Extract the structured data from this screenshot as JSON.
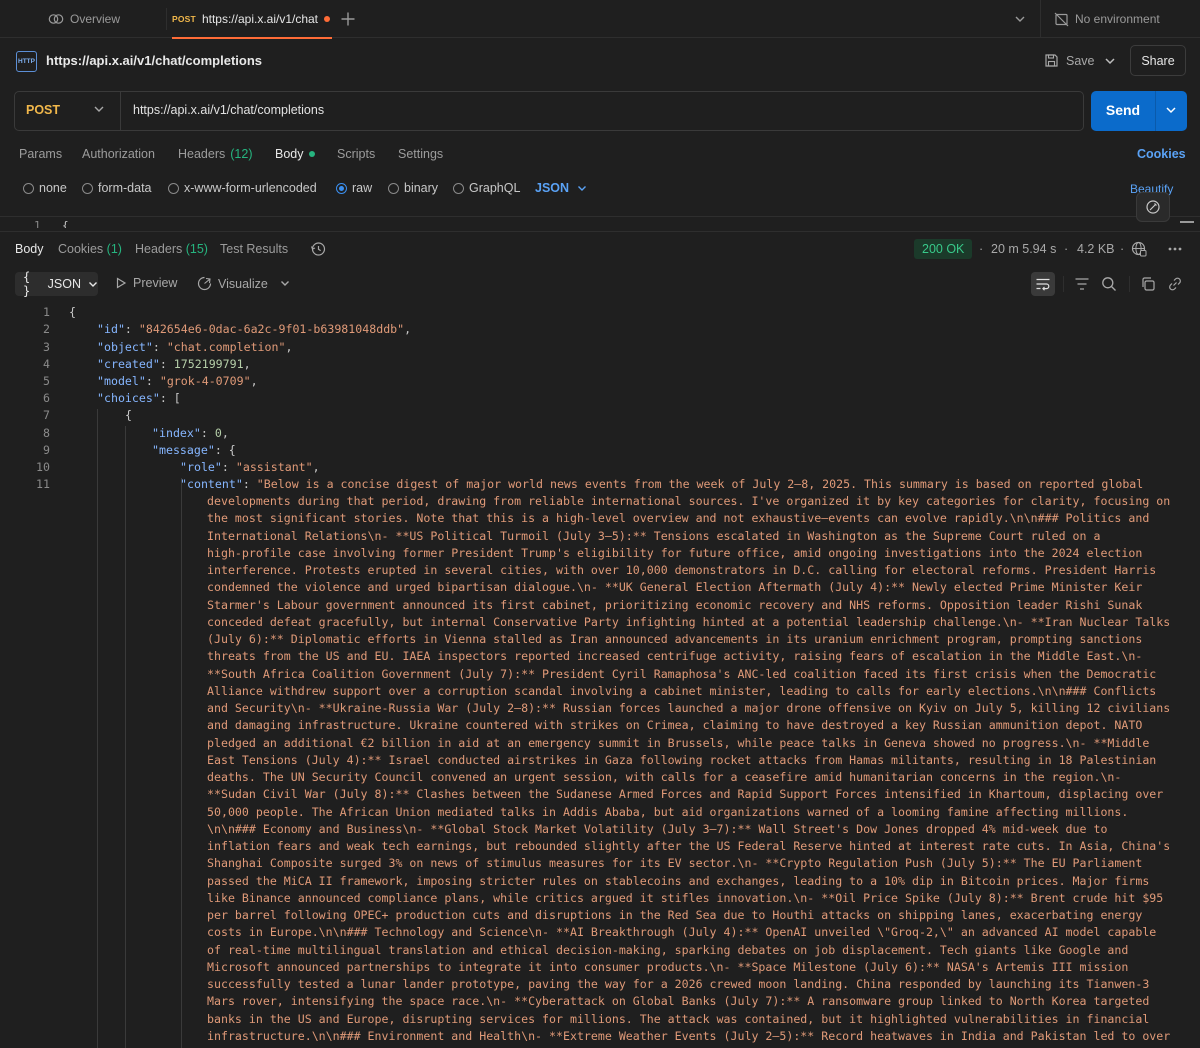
{
  "tabs": {
    "overview_label": "Overview",
    "active_method": "POST",
    "active_label": "https://api.x.ai/v1/chat",
    "environment_label": "No environment"
  },
  "header": {
    "badge": "HTTP",
    "title": "https://api.x.ai/v1/chat/completions",
    "save_label": "Save",
    "share_label": "Share"
  },
  "request": {
    "method": "POST",
    "url": "https://api.x.ai/v1/chat/completions",
    "send_label": "Send",
    "tabs": {
      "params": "Params",
      "authorization": "Authorization",
      "headers": "Headers",
      "headers_count": "(12)",
      "body": "Body",
      "scripts": "Scripts",
      "settings": "Settings"
    },
    "cookies_link": "Cookies",
    "body_types": {
      "none": "none",
      "form_data": "form-data",
      "urlencoded": "x-www-form-urlencoded",
      "raw": "raw",
      "binary": "binary",
      "graphql": "GraphQL"
    },
    "raw_format": "JSON",
    "beautify_label": "Beautify",
    "editor_peek_line": "1",
    "editor_peek_text": "{"
  },
  "response": {
    "tabs": {
      "body": "Body",
      "cookies": "Cookies",
      "cookies_count": "(1)",
      "headers": "Headers",
      "headers_count": "(15)",
      "test_results": "Test Results"
    },
    "status": "200 OK",
    "time": "20 m 5.94 s",
    "size": "4.2 KB",
    "view_format": "JSON",
    "preview_label": "Preview",
    "visualize_label": "Visualize",
    "json_lines": {
      "l1": "{",
      "id_key": "\"id\"",
      "id_val": "\"842654e6-0dac-6a2c-9f01-b63981048ddb\"",
      "object_key": "\"object\"",
      "object_val": "\"chat.completion\"",
      "created_key": "\"created\"",
      "created_val": "1752199791",
      "model_key": "\"model\"",
      "model_val": "\"grok-4-0709\"",
      "choices_key": "\"choices\"",
      "brace_open": "{",
      "index_key": "\"index\"",
      "index_val": "0",
      "message_key": "\"message\"",
      "role_key": "\"role\"",
      "role_val": "\"assistant\"",
      "content_key": "\"content\"",
      "content_first": "\"Below is a concise digest of major world news events from the week of July 2–8, 2025. This summary is based on reported global",
      "content_rest": [
        "developments during that period, drawing from reliable international sources. I've organized it by key categories for clarity, focusing on",
        "the most significant stories. Note that this is a high-level overview and not exhaustive—events can evolve rapidly.\\n\\n### Politics and",
        "International Relations\\n- **US Political Turmoil (July 3–5):** Tensions escalated in Washington as the Supreme Court ruled on a",
        "high-profile case involving former President Trump's eligibility for future office, amid ongoing investigations into the 2024 election",
        "interference. Protests erupted in several cities, with over 10,000 demonstrators in D.C. calling for electoral reforms. President Harris",
        "condemned the violence and urged bipartisan dialogue.\\n- **UK General Election Aftermath (July 4):** Newly elected Prime Minister Keir",
        "Starmer's Labour government announced its first cabinet, prioritizing economic recovery and NHS reforms. Opposition leader Rishi Sunak",
        "conceded defeat gracefully, but internal Conservative Party infighting hinted at a potential leadership challenge.\\n- **Iran Nuclear Talks",
        "(July 6):** Diplomatic efforts in Vienna stalled as Iran announced advancements in its uranium enrichment program, prompting sanctions",
        "threats from the US and EU. IAEA inspectors reported increased centrifuge activity, raising fears of escalation in the Middle East.\\n-",
        "**South Africa Coalition Government (July 7):** President Cyril Ramaphosa's ANC-led coalition faced its first crisis when the Democratic",
        "Alliance withdrew support over a corruption scandal involving a cabinet minister, leading to calls for early elections.\\n\\n### Conflicts",
        "and Security\\n- **Ukraine-Russia War (July 2–8):** Russian forces launched a major drone offensive on Kyiv on July 5, killing 12 civilians",
        "and damaging infrastructure. Ukraine countered with strikes on Crimea, claiming to have destroyed a key Russian ammunition depot. NATO",
        "pledged an additional €2 billion in aid at an emergency summit in Brussels, while peace talks in Geneva showed no progress.\\n- **Middle",
        "East Tensions (July 4):** Israel conducted airstrikes in Gaza following rocket attacks from Hamas militants, resulting in 18 Palestinian",
        "deaths. The UN Security Council convened an urgent session, with calls for a ceasefire amid humanitarian concerns in the region.\\n-",
        "**Sudan Civil War (July 8):** Clashes between the Sudanese Armed Forces and Rapid Support Forces intensified in Khartoum, displacing over",
        "50,000 people. The African Union mediated talks in Addis Ababa, but aid organizations warned of a looming famine affecting millions.",
        "\\n\\n### Economy and Business\\n- **Global Stock Market Volatility (July 3–7):** Wall Street's Dow Jones dropped 4% mid-week due to",
        "inflation fears and weak tech earnings, but rebounded slightly after the US Federal Reserve hinted at interest rate cuts. In Asia, China's",
        "Shanghai Composite surged 3% on news of stimulus measures for its EV sector.\\n- **Crypto Regulation Push (July 5):** The EU Parliament",
        "passed the MiCA II framework, imposing stricter rules on stablecoins and exchanges, leading to a 10% dip in Bitcoin prices. Major firms",
        "like Binance announced compliance plans, while critics argued it stifles innovation.\\n- **Oil Price Spike (July 8):** Brent crude hit $95",
        "per barrel following OPEC+ production cuts and disruptions in the Red Sea due to Houthi attacks on shipping lanes, exacerbating energy",
        "costs in Europe.\\n\\n### Technology and Science\\n- **AI Breakthrough (July 4):** OpenAI unveiled \\\"Groq-2,\\\" an advanced AI model capable",
        "of real-time multilingual translation and ethical decision-making, sparking debates on job displacement. Tech giants like Google and",
        "Microsoft announced partnerships to integrate it into consumer products.\\n- **Space Milestone (July 6):** NASA's Artemis III mission",
        "successfully tested a lunar lander prototype, paving the way for a 2026 crewed moon landing. China responded by launching its Tianwen-3",
        "Mars rover, intensifying the space race.\\n- **Cyberattack on Global Banks (July 7):** A ransomware group linked to North Korea targeted",
        "banks in the US and Europe, disrupting services for millions. The attack was contained, but it highlighted vulnerabilities in financial",
        "infrastructure.\\n\\n### Environment and Health\\n- **Extreme Weather Events (July 2–5):** Record heatwaves in India and Pakistan led to over"
      ],
      "line_numbers": [
        "1",
        "2",
        "3",
        "4",
        "5",
        "6",
        "7",
        "8",
        "9",
        "10",
        "11"
      ]
    }
  },
  "colors": {
    "accent_orange": "#ff6c37",
    "send_blue": "#0b6bcb",
    "link_blue": "#5aa2f5",
    "method_yellow": "#f2b84b",
    "status_green": "#38c98a",
    "json_key": "#86b6ff",
    "json_string": "#e09a78"
  },
  "icons": [
    "overview-icon",
    "plus-icon",
    "chevron-down-icon",
    "no-environment-icon",
    "http-icon",
    "save-icon",
    "history-icon",
    "globe-icon",
    "more-icon",
    "play-icon",
    "visualize-icon",
    "wrap-icon",
    "filter-icon",
    "search-icon",
    "copy-icon",
    "link-icon",
    "magic-icon"
  ]
}
